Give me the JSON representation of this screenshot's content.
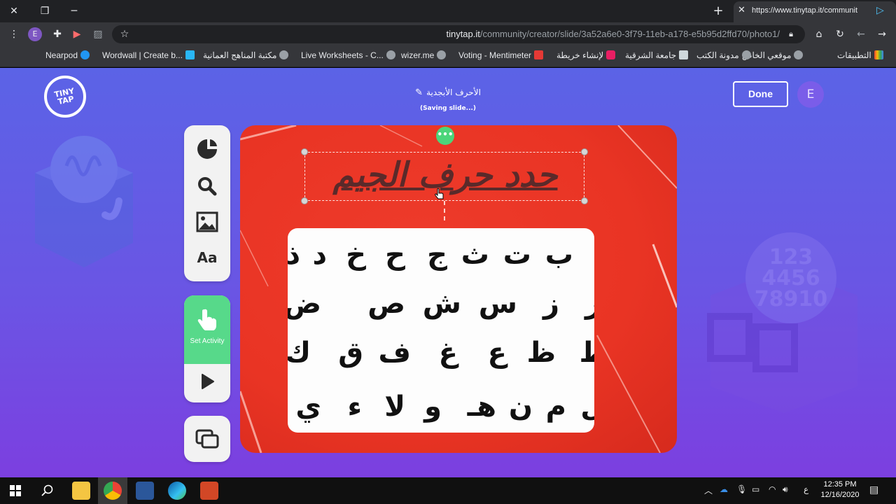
{
  "tab": {
    "url_label": "https://www.tinytap.it/communit"
  },
  "address_bar": {
    "host": "tinytap.it",
    "path": "/community/creator/slide/3a52a6e0-3f79-11eb-a178-e5b95d2ffd70/photo1/"
  },
  "bookmarks": [
    {
      "label": "التطبيقات",
      "color": "#f4b400"
    },
    {
      "label": "موقعي الخاص",
      "color": "#9aa0a6"
    },
    {
      "label": "مدونة الكتب",
      "color": "#9aa0a6"
    },
    {
      "label": "جامعة الشرقية",
      "color": "#cfd8dc"
    },
    {
      "label": "لإنشاء خريطة",
      "color": "#e91e63"
    },
    {
      "label": "Voting - Mentimeter",
      "color": "#e53935"
    },
    {
      "label": "wizer.me",
      "color": "#9aa0a6"
    },
    {
      "label": "Live Worksheets - C...",
      "color": "#9aa0a6"
    },
    {
      "label": "مكتبة المناهج العمانية",
      "color": "#9aa0a6"
    },
    {
      "label": "Wordwall | Create b...",
      "color": "#29b6f6"
    },
    {
      "label": "Nearpod",
      "color": "#2196f3"
    }
  ],
  "app": {
    "logo_text": "TINY TAP",
    "slide_title": "الأحرف الأبجدية",
    "saving_status": "(Saving slide...)",
    "done_label": "Done",
    "avatar_initial": "E",
    "set_activity_label": "Set Activity",
    "font_tool_label": "Aa",
    "more_label": "•••"
  },
  "slide": {
    "heading": "حدد حرف الجيم",
    "letter_rows": [
      [
        "ب",
        "ت",
        "ث",
        "ج",
        "ح",
        "خ",
        "د",
        "ذ"
      ],
      [
        "ر",
        "ز",
        "س",
        "ش",
        "ص",
        "ض"
      ],
      [
        "ط",
        "ظ",
        "ع",
        "غ",
        "ف",
        "ق",
        "ك"
      ],
      [
        "ل",
        "م",
        "ن",
        "هـ",
        "و",
        "لا",
        "ء",
        "ي"
      ]
    ]
  },
  "taskbar": {
    "time": "12:35 PM",
    "date": "12/16/2020",
    "lang": "ع"
  },
  "colors": {
    "app_bg_top": "#5b63e6",
    "slide_red": "#e93424",
    "accent_green": "#57d98a"
  }
}
